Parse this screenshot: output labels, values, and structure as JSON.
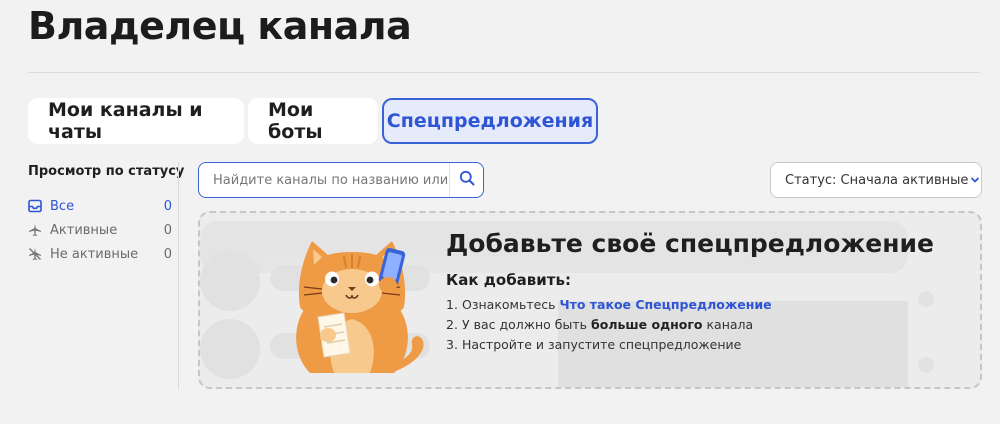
{
  "page": {
    "title": "Владелец канала"
  },
  "tabs": [
    {
      "label": "Мои каналы и чаты",
      "active": false
    },
    {
      "label": "Мои боты",
      "active": false
    },
    {
      "label": "Спецпредложения",
      "active": true
    }
  ],
  "sidebar": {
    "heading": "Просмотр по статусу",
    "items": [
      {
        "label": "Все",
        "count": "0",
        "icon": "inbox-icon",
        "active": true
      },
      {
        "label": "Активные",
        "count": "0",
        "icon": "airplane-icon",
        "active": false
      },
      {
        "label": "Не активные",
        "count": "0",
        "icon": "airplane-off-icon",
        "active": false
      }
    ]
  },
  "search": {
    "placeholder": "Найдите каналы по названию или оп",
    "value": "",
    "icon": "search-icon"
  },
  "sort": {
    "value": "Статус: Сначала активные",
    "icon": "chevron-down-icon"
  },
  "promo": {
    "title": "Добавьте своё спецпредложение",
    "subtitle": "Как добавить:",
    "steps": [
      {
        "num": "1.",
        "before": "Ознакомьтесь ",
        "link": "Что такое Спецпредложение"
      },
      {
        "num": "2.",
        "before": "У вас должно быть ",
        "bold": "больше одного",
        "after": " канала"
      },
      {
        "num": "3.",
        "text": "Настройте и запустите спецпредложение"
      }
    ],
    "illustration": "cat-with-phone-illustration"
  },
  "colors": {
    "accent": "#3b63d8",
    "accent_text": "#2f55d4",
    "active_tab_bg": "#e6ebfc",
    "background": "#f2f2f2",
    "cat_orange": "#ef9a45"
  }
}
